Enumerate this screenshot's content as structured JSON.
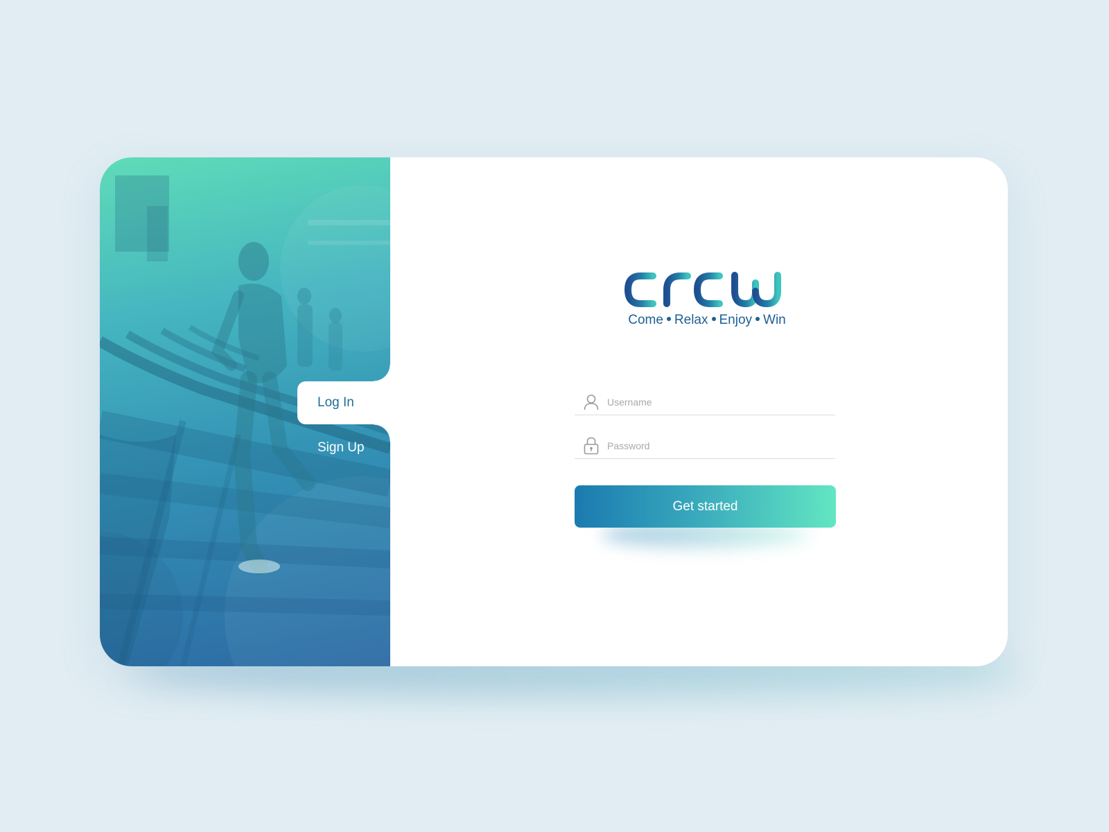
{
  "brand": {
    "name": "crew",
    "tagline": [
      "Come",
      "Relax",
      "Enjoy",
      "Win"
    ]
  },
  "tabs": {
    "login_label": "Log In",
    "signup_label": "Sign Up",
    "active": "login"
  },
  "form": {
    "username": {
      "placeholder": "Username",
      "value": "",
      "icon": "user-icon"
    },
    "password": {
      "placeholder": "Password",
      "value": "",
      "icon": "lock-icon"
    },
    "submit_label": "Get started"
  },
  "colors": {
    "background": "#e1edf3",
    "brand_dark": "#1f5f95",
    "accent_start": "#1b7ab0",
    "accent_end": "#62e6c2",
    "panel_top": "#5fdcb8",
    "panel_bottom": "#2c6aa4"
  }
}
